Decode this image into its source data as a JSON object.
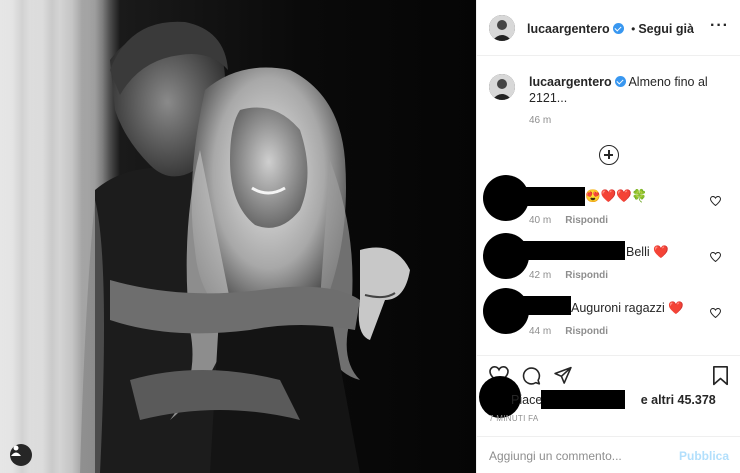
{
  "post": {
    "username": "lucaargentero",
    "follow_label": "Segui già",
    "caption": "Almeno fino al 2121...",
    "caption_time": "46 m"
  },
  "comments": [
    {
      "text": "😍❤️❤️🍀",
      "time": "40 m",
      "reply_label": "Rispondi"
    },
    {
      "text": "Belli ❤️",
      "time": "42 m",
      "reply_label": "Rispondi"
    },
    {
      "text": "Auguroni ragazzi ❤️",
      "time": "44 m",
      "reply_label": "Rispondi"
    }
  ],
  "likes": {
    "prefix": "Piace a",
    "suffix": "e altri 45.378"
  },
  "post_time": "7 MINUTI FA",
  "add_comment": {
    "placeholder": "Aggiungi un commento...",
    "publish_label": "Pubblica"
  },
  "icons": {
    "like": "heart-icon",
    "comment": "comment-icon",
    "share": "paper-plane-icon",
    "save": "bookmark-icon",
    "more": "more-options-icon",
    "add": "plus-circle-icon",
    "user": "user-tag-icon"
  },
  "colors": {
    "verified": "#3897f0",
    "publish_disabled": "#b2dffc",
    "muted": "#8e8e8e",
    "text": "#262626"
  }
}
